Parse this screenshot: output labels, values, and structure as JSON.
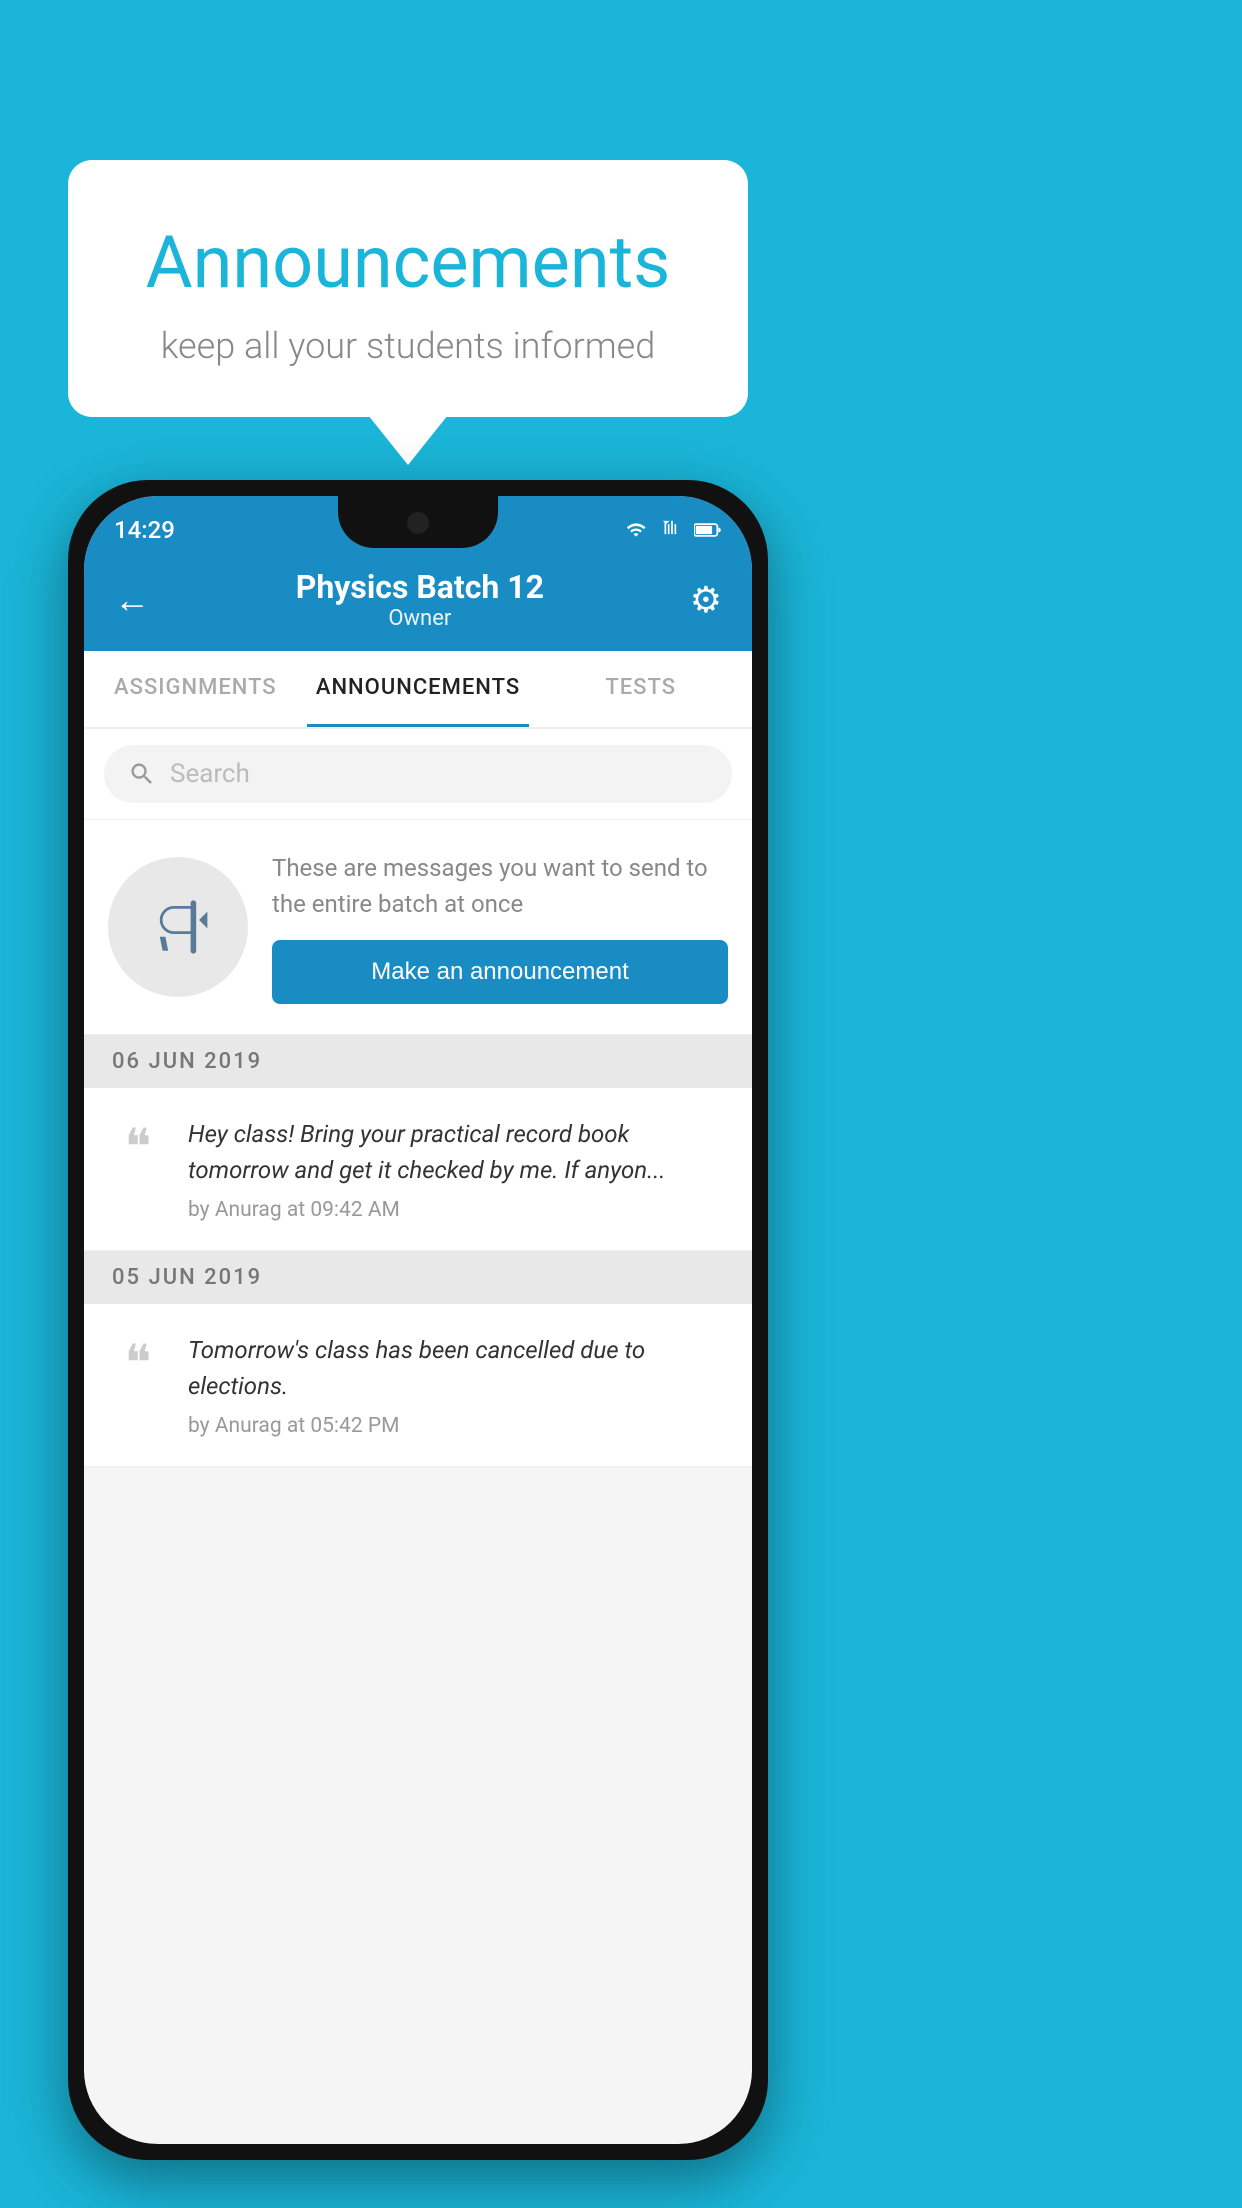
{
  "bubble": {
    "title": "Announcements",
    "subtitle": "keep all your students informed"
  },
  "phone": {
    "status": {
      "time": "14:29"
    },
    "header": {
      "title": "Physics Batch 12",
      "subtitle": "Owner"
    },
    "tabs": [
      {
        "label": "ASSIGNMENTS",
        "active": false
      },
      {
        "label": "ANNOUNCEMENTS",
        "active": true
      },
      {
        "label": "TESTS",
        "active": false
      }
    ],
    "search": {
      "placeholder": "Search"
    },
    "cta": {
      "description": "These are messages you want to send to the entire batch at once",
      "button_label": "Make an announcement"
    },
    "announcements": [
      {
        "date": "06  JUN  2019",
        "text": "Hey class! Bring your practical record book tomorrow and get it checked by me. If anyon...",
        "meta": "by Anurag at 09:42 AM"
      },
      {
        "date": "05  JUN  2019",
        "text": "Tomorrow's class has been cancelled due to elections.",
        "meta": "by Anurag at 05:42 PM"
      }
    ]
  },
  "colors": {
    "background": "#1ab5d8",
    "header": "#1a8cc4",
    "accent": "#1a8cc4",
    "white": "#ffffff"
  }
}
